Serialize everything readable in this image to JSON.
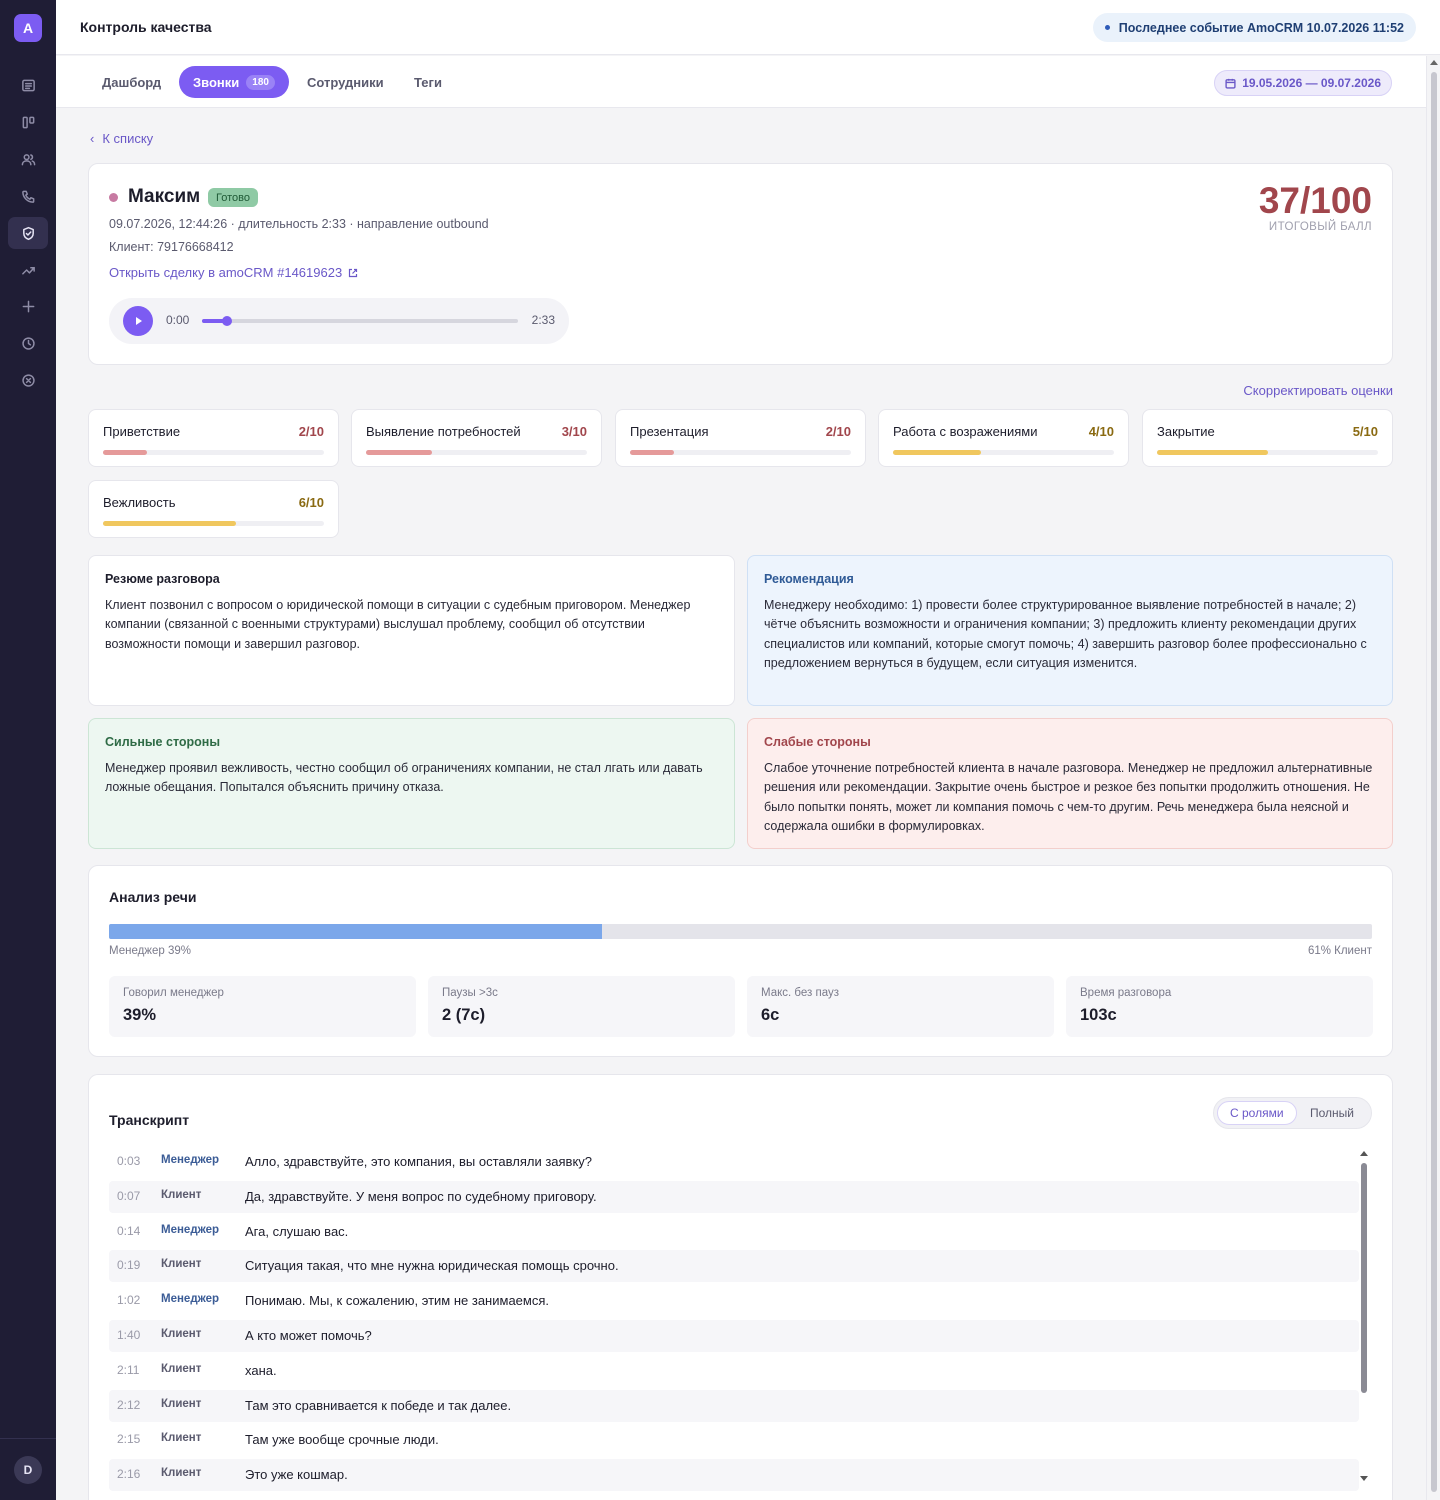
{
  "app": {
    "logo_letter": "A",
    "user_initial": "D"
  },
  "sidebar": {
    "items": [
      {
        "icon": "list-icon",
        "active": false
      },
      {
        "icon": "kanban-icon",
        "active": false
      },
      {
        "icon": "users-icon",
        "active": false
      },
      {
        "icon": "phone-icon",
        "active": false
      },
      {
        "icon": "shield-check-icon",
        "active": true
      },
      {
        "icon": "trending-up-icon",
        "active": false
      },
      {
        "icon": "plus-icon",
        "active": false
      },
      {
        "icon": "clock-icon",
        "active": false
      },
      {
        "icon": "close-circle-icon",
        "active": false
      }
    ]
  },
  "header": {
    "title": "Контроль качества",
    "last_event": "Последнее событие AmoCRM 10.07.2026 11:52"
  },
  "tabs": [
    {
      "label": "Дашборд",
      "active": false
    },
    {
      "label": "Звонки",
      "badge": "180",
      "active": true
    },
    {
      "label": "Сотрудники",
      "active": false
    },
    {
      "label": "Теги",
      "active": false
    }
  ],
  "date_range": "19.05.2026 — 09.07.2026",
  "back_label": "К списку",
  "call": {
    "employee": "Максим",
    "status": "Готово",
    "meta_line": "09.07.2026, 12:44:26 · длительность 2:33 · направление outbound",
    "client_line": "Клиент: 79176668412",
    "deal_link": "Открыть сделку в amoCRM #14619623",
    "score": "37/100",
    "score_label": "ИТОГОВЫЙ БАЛЛ",
    "player": {
      "current": "0:00",
      "duration": "2:33",
      "progress": 0.08
    }
  },
  "correct_label": "Скорректировать оценки",
  "criteria": [
    {
      "name": "Приветствие",
      "value": "2/10",
      "score": 2,
      "color": "#e59a9a",
      "text_color": "#a1464c"
    },
    {
      "name": "Выявление потребностей",
      "value": "3/10",
      "score": 3,
      "color": "#e59a9a",
      "text_color": "#a1464c"
    },
    {
      "name": "Презентация",
      "value": "2/10",
      "score": 2,
      "color": "#e59a9a",
      "text_color": "#a1464c"
    },
    {
      "name": "Работа с возражениями",
      "value": "4/10",
      "score": 4,
      "color": "#f0c75e",
      "text_color": "#8a6a12"
    },
    {
      "name": "Закрытие",
      "value": "5/10",
      "score": 5,
      "color": "#f0c75e",
      "text_color": "#8a6a12"
    },
    {
      "name": "Вежливость",
      "value": "6/10",
      "score": 6,
      "color": "#f0c75e",
      "text_color": "#8a6a12"
    }
  ],
  "summary": {
    "title": "Резюме разговора",
    "text": "Клиент позвонил с вопросом о юридической помощи в ситуации с судебным приговором. Менеджер компании (связанной с военными структурами) выслушал проблему, сообщил об отсутствии возможности помощи и завершил разговор."
  },
  "recommendation": {
    "title": "Рекомендация",
    "text": "Менеджеру необходимо: 1) провести более структурированное выявление потребностей в начале; 2) чётче объяснить возможности и ограничения компании; 3) предложить клиенту рекомендации других специалистов или компаний, которые смогут помочь; 4) завершить разговор более профессионально с предложением вернуться в будущем, если ситуация изменится."
  },
  "strengths": {
    "title": "Сильные стороны",
    "text": "Менеджер проявил вежливость, честно сообщил об ограничениях компании, не стал лгать или давать ложные обещания. Попытался объяснить причину отказа."
  },
  "weaknesses": {
    "title": "Слабые стороны",
    "text": "Слабое уточнение потребностей клиента в начале разговора. Менеджер не предложил альтернативные решения или рекомендации. Закрытие очень быстрое и резкое без попытки продолжить отношения. Не было попытки понять, может ли компания помочь с чем-то другим. Речь менеджера была неясной и содержала ошибки в формулировках."
  },
  "speech": {
    "title": "Анализ речи",
    "manager_share": 0.39,
    "manager_label": "Менеджер 39%",
    "client_label": "61% Клиент",
    "stats": [
      {
        "label": "Говорил менеджер",
        "value": "39%"
      },
      {
        "label": "Паузы >3с",
        "value": "2 (7с)"
      },
      {
        "label": "Макс. без пауз",
        "value": "6с"
      },
      {
        "label": "Время разговора",
        "value": "103с"
      }
    ]
  },
  "transcript": {
    "title": "Транскрипт",
    "mode_roles": "С ролями",
    "mode_full": "Полный",
    "rows": [
      {
        "time": "0:03",
        "role": "Менеджер",
        "text": "Алло, здравствуйте, это компания, вы оставляли заявку?"
      },
      {
        "time": "0:07",
        "role": "Клиент",
        "text": "Да, здравствуйте. У меня вопрос по судебному приговору."
      },
      {
        "time": "0:14",
        "role": "Менеджер",
        "text": "Ага, слушаю вас."
      },
      {
        "time": "0:19",
        "role": "Клиент",
        "text": "Ситуация такая, что мне нужна юридическая помощь срочно."
      },
      {
        "time": "1:02",
        "role": "Менеджер",
        "text": "Понимаю. Мы, к сожалению, этим не занимаемся."
      },
      {
        "time": "1:40",
        "role": "Клиент",
        "text": "А кто может помочь?"
      },
      {
        "time": "2:11",
        "role": "Клиент",
        "text": "хана."
      },
      {
        "time": "2:12",
        "role": "Клиент",
        "text": "Там это сравнивается к победе и так далее."
      },
      {
        "time": "2:15",
        "role": "Клиент",
        "text": "Там уже вообще срочные люди."
      },
      {
        "time": "2:16",
        "role": "Клиент",
        "text": "Это уже кошмар."
      }
    ]
  }
}
